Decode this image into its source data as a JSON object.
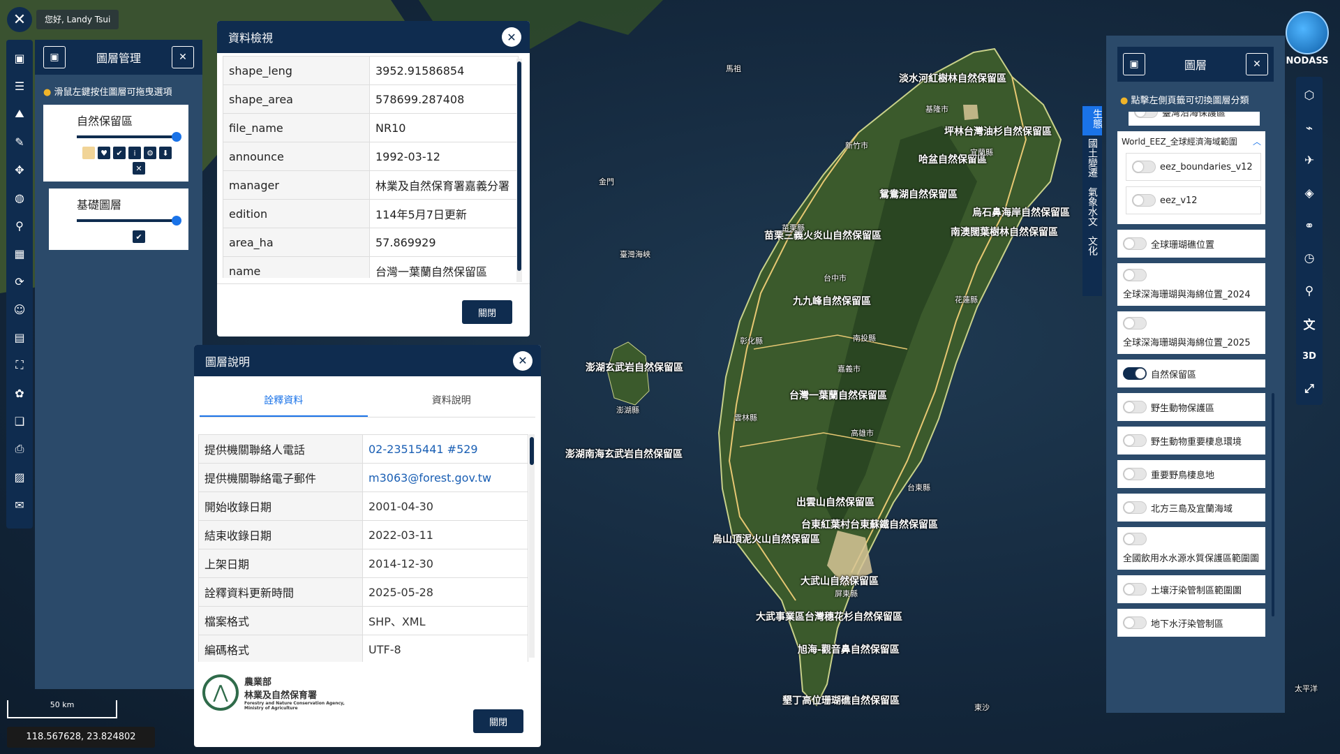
{
  "header": {
    "close_icon": "close-icon",
    "greeting": "您好, Landy Tsui"
  },
  "left_toolbar": [
    "map-icon",
    "list-icon",
    "layers-stack-icon",
    "brush-icon",
    "compass-icon",
    "globe-icon",
    "pin-icon",
    "grid-icon",
    "refresh-icon",
    "user-icon",
    "table-icon",
    "select-icon",
    "puzzle-icon",
    "book-icon",
    "print-icon",
    "image-icon",
    "chat-icon"
  ],
  "layer_mgmt": {
    "title": "圖層管理",
    "tip": "滑鼠左鍵按住圖層可拖曳選項",
    "layers": [
      {
        "name": "自然保留區",
        "opacity": 1.0
      },
      {
        "name": "基礎圖層",
        "opacity": 1.0
      }
    ],
    "tools": [
      "▦",
      "♥",
      "✔",
      "i",
      "⚙",
      "⬇",
      "✕"
    ]
  },
  "data_view": {
    "title": "資料檢視",
    "rows": [
      {
        "k": "shape_leng",
        "v": "3952.91586854"
      },
      {
        "k": "shape_area",
        "v": "578699.287408"
      },
      {
        "k": "file_name",
        "v": "NR10"
      },
      {
        "k": "announce",
        "v": "1992-03-12"
      },
      {
        "k": "manager",
        "v": "林業及自然保育署嘉義分署"
      },
      {
        "k": "edition",
        "v": "114年5月7日更新"
      },
      {
        "k": "area_ha",
        "v": "57.869929"
      },
      {
        "k": "name",
        "v": "台灣一葉蘭自然保留區"
      }
    ],
    "close_label": "關閉"
  },
  "layer_desc": {
    "title": "圖層說明",
    "tabs": [
      "詮釋資料",
      "資料說明"
    ],
    "active_tab": 0,
    "rows": [
      {
        "k": "提供機關聯絡人電話",
        "v": "02-23515441 #529",
        "link": true
      },
      {
        "k": "提供機關聯絡電子郵件",
        "v": "m3063@forest.gov.tw",
        "link": true
      },
      {
        "k": "開始收錄日期",
        "v": "2001-04-30"
      },
      {
        "k": "結束收錄日期",
        "v": "2022-03-11"
      },
      {
        "k": "上架日期",
        "v": "2014-12-30"
      },
      {
        "k": "詮釋資料更新時間",
        "v": "2025-05-28"
      },
      {
        "k": "檔案格式",
        "v": "SHP、XML"
      },
      {
        "k": "編碼格式",
        "v": "UTF-8"
      }
    ],
    "agency_line1": "農業部",
    "agency_line2": "林業及自然保育署",
    "agency_en1": "Forestry and Nature Conservation Agency,",
    "agency_en2": "Ministry of Agriculture",
    "close_label": "關閉"
  },
  "right_panel": {
    "title": "圖層",
    "tip": "點擊左側頁籤可切換圖層分類",
    "partial_item": "臺灣沿海保護區",
    "group_title": "World_EEZ_全球經濟海域範圍",
    "group_items": [
      {
        "name": "eez_boundaries_v12",
        "on": false
      },
      {
        "name": "eez_v12",
        "on": false
      }
    ],
    "items": [
      {
        "name": "全球珊瑚礁位置",
        "on": false,
        "stack": false
      },
      {
        "name": "全球深海珊瑚與海綿位置_2024",
        "on": false,
        "stack": true
      },
      {
        "name": "全球深海珊瑚與海綿位置_2025",
        "on": false,
        "stack": true
      },
      {
        "name": "自然保留區",
        "on": true,
        "stack": false
      },
      {
        "name": "野生動物保護區",
        "on": false,
        "stack": false
      },
      {
        "name": "野生動物重要棲息環境",
        "on": false,
        "stack": false
      },
      {
        "name": "重要野鳥棲息地",
        "on": false,
        "stack": false
      },
      {
        "name": "北方三島及宜蘭海域",
        "on": false,
        "stack": false
      },
      {
        "name": "全國飲用水水源水質保護區範圍圖",
        "on": false,
        "stack": true
      },
      {
        "name": "土壤汙染管制區範圍圖",
        "on": false,
        "stack": false
      },
      {
        "name": "地下水汙染管制區",
        "on": false,
        "stack": false
      }
    ]
  },
  "category_tabs": [
    "生態",
    "國土變遷",
    "氣象水文",
    "文化"
  ],
  "active_category": 0,
  "right_toolbar": [
    "cube-icon",
    "satellite-icon",
    "drone-icon",
    "layers-icon",
    "share-icon",
    "clock-icon",
    "search-icon",
    "translate-icon",
    "3d-icon",
    "fullscreen-icon"
  ],
  "right_toolbar_text": {
    "3d": "3D"
  },
  "logo": "NODASS",
  "map": {
    "coordinate": "118.567628, 23.824802",
    "scale_label": "50 km",
    "ocean_label": "太平洋",
    "labels": [
      "淡水河紅樹林自然保留區",
      "坪林台灣油杉自然保留區",
      "哈盆自然保留區",
      "鴛鴦湖自然保留區",
      "烏石鼻海岸自然保留區",
      "苗栗三義火炎山自然保留區",
      "南澳闊葉樹林自然保留區",
      "九九峰自然保留區",
      "澎湖玄武岩自然保留區",
      "台灣一葉蘭自然保留區",
      "澎湖南海玄武岩自然保留區",
      "出雲山自然保留區",
      "台東紅葉村台東蘇鐵自然保留區",
      "烏山頂泥火山自然保留區",
      "大武山自然保留區",
      "大武事業區台灣穗花杉自然保留區",
      "旭海-觀音鼻自然保留區",
      "墾丁高位珊瑚礁自然保留區",
      "臺灣海峽",
      "基隆市",
      "新竹市",
      "台中市",
      "嘉義市",
      "高雄市",
      "花蓮縣",
      "台東縣",
      "屏東縣",
      "宜蘭縣",
      "苗栗縣",
      "南投縣",
      "彰化縣",
      "雲林縣",
      "澎湖縣",
      "金門",
      "馬祖",
      "東沙"
    ]
  }
}
